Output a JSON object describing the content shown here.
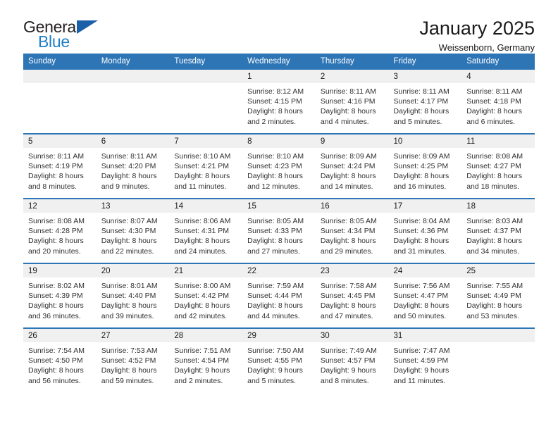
{
  "brand": {
    "name_part1": "General",
    "name_part2": "Blue",
    "triangle_icon": "triangle-icon",
    "accent_color": "#1f7fc4",
    "logo_dark_color": "#231f20"
  },
  "header": {
    "title": "January 2025",
    "subtitle": "Weissenborn, Germany"
  },
  "theme": {
    "header_blue": "#2e75b6",
    "daynum_band": "#f0f0f0",
    "text_color": "#303030"
  },
  "calendar": {
    "weekday_headers": [
      "Sunday",
      "Monday",
      "Tuesday",
      "Wednesday",
      "Thursday",
      "Friday",
      "Saturday"
    ],
    "weeks": [
      [
        {
          "day": "",
          "empty": true,
          "sunrise": "",
          "sunset": "",
          "daylight1": "",
          "daylight2": ""
        },
        {
          "day": "",
          "empty": true,
          "sunrise": "",
          "sunset": "",
          "daylight1": "",
          "daylight2": ""
        },
        {
          "day": "",
          "empty": true,
          "sunrise": "",
          "sunset": "",
          "daylight1": "",
          "daylight2": ""
        },
        {
          "day": "1",
          "empty": false,
          "sunrise": "Sunrise: 8:12 AM",
          "sunset": "Sunset: 4:15 PM",
          "daylight1": "Daylight: 8 hours",
          "daylight2": "and 2 minutes."
        },
        {
          "day": "2",
          "empty": false,
          "sunrise": "Sunrise: 8:11 AM",
          "sunset": "Sunset: 4:16 PM",
          "daylight1": "Daylight: 8 hours",
          "daylight2": "and 4 minutes."
        },
        {
          "day": "3",
          "empty": false,
          "sunrise": "Sunrise: 8:11 AM",
          "sunset": "Sunset: 4:17 PM",
          "daylight1": "Daylight: 8 hours",
          "daylight2": "and 5 minutes."
        },
        {
          "day": "4",
          "empty": false,
          "sunrise": "Sunrise: 8:11 AM",
          "sunset": "Sunset: 4:18 PM",
          "daylight1": "Daylight: 8 hours",
          "daylight2": "and 6 minutes."
        }
      ],
      [
        {
          "day": "5",
          "empty": false,
          "sunrise": "Sunrise: 8:11 AM",
          "sunset": "Sunset: 4:19 PM",
          "daylight1": "Daylight: 8 hours",
          "daylight2": "and 8 minutes."
        },
        {
          "day": "6",
          "empty": false,
          "sunrise": "Sunrise: 8:11 AM",
          "sunset": "Sunset: 4:20 PM",
          "daylight1": "Daylight: 8 hours",
          "daylight2": "and 9 minutes."
        },
        {
          "day": "7",
          "empty": false,
          "sunrise": "Sunrise: 8:10 AM",
          "sunset": "Sunset: 4:21 PM",
          "daylight1": "Daylight: 8 hours",
          "daylight2": "and 11 minutes."
        },
        {
          "day": "8",
          "empty": false,
          "sunrise": "Sunrise: 8:10 AM",
          "sunset": "Sunset: 4:23 PM",
          "daylight1": "Daylight: 8 hours",
          "daylight2": "and 12 minutes."
        },
        {
          "day": "9",
          "empty": false,
          "sunrise": "Sunrise: 8:09 AM",
          "sunset": "Sunset: 4:24 PM",
          "daylight1": "Daylight: 8 hours",
          "daylight2": "and 14 minutes."
        },
        {
          "day": "10",
          "empty": false,
          "sunrise": "Sunrise: 8:09 AM",
          "sunset": "Sunset: 4:25 PM",
          "daylight1": "Daylight: 8 hours",
          "daylight2": "and 16 minutes."
        },
        {
          "day": "11",
          "empty": false,
          "sunrise": "Sunrise: 8:08 AM",
          "sunset": "Sunset: 4:27 PM",
          "daylight1": "Daylight: 8 hours",
          "daylight2": "and 18 minutes."
        }
      ],
      [
        {
          "day": "12",
          "empty": false,
          "sunrise": "Sunrise: 8:08 AM",
          "sunset": "Sunset: 4:28 PM",
          "daylight1": "Daylight: 8 hours",
          "daylight2": "and 20 minutes."
        },
        {
          "day": "13",
          "empty": false,
          "sunrise": "Sunrise: 8:07 AM",
          "sunset": "Sunset: 4:30 PM",
          "daylight1": "Daylight: 8 hours",
          "daylight2": "and 22 minutes."
        },
        {
          "day": "14",
          "empty": false,
          "sunrise": "Sunrise: 8:06 AM",
          "sunset": "Sunset: 4:31 PM",
          "daylight1": "Daylight: 8 hours",
          "daylight2": "and 24 minutes."
        },
        {
          "day": "15",
          "empty": false,
          "sunrise": "Sunrise: 8:05 AM",
          "sunset": "Sunset: 4:33 PM",
          "daylight1": "Daylight: 8 hours",
          "daylight2": "and 27 minutes."
        },
        {
          "day": "16",
          "empty": false,
          "sunrise": "Sunrise: 8:05 AM",
          "sunset": "Sunset: 4:34 PM",
          "daylight1": "Daylight: 8 hours",
          "daylight2": "and 29 minutes."
        },
        {
          "day": "17",
          "empty": false,
          "sunrise": "Sunrise: 8:04 AM",
          "sunset": "Sunset: 4:36 PM",
          "daylight1": "Daylight: 8 hours",
          "daylight2": "and 31 minutes."
        },
        {
          "day": "18",
          "empty": false,
          "sunrise": "Sunrise: 8:03 AM",
          "sunset": "Sunset: 4:37 PM",
          "daylight1": "Daylight: 8 hours",
          "daylight2": "and 34 minutes."
        }
      ],
      [
        {
          "day": "19",
          "empty": false,
          "sunrise": "Sunrise: 8:02 AM",
          "sunset": "Sunset: 4:39 PM",
          "daylight1": "Daylight: 8 hours",
          "daylight2": "and 36 minutes."
        },
        {
          "day": "20",
          "empty": false,
          "sunrise": "Sunrise: 8:01 AM",
          "sunset": "Sunset: 4:40 PM",
          "daylight1": "Daylight: 8 hours",
          "daylight2": "and 39 minutes."
        },
        {
          "day": "21",
          "empty": false,
          "sunrise": "Sunrise: 8:00 AM",
          "sunset": "Sunset: 4:42 PM",
          "daylight1": "Daylight: 8 hours",
          "daylight2": "and 42 minutes."
        },
        {
          "day": "22",
          "empty": false,
          "sunrise": "Sunrise: 7:59 AM",
          "sunset": "Sunset: 4:44 PM",
          "daylight1": "Daylight: 8 hours",
          "daylight2": "and 44 minutes."
        },
        {
          "day": "23",
          "empty": false,
          "sunrise": "Sunrise: 7:58 AM",
          "sunset": "Sunset: 4:45 PM",
          "daylight1": "Daylight: 8 hours",
          "daylight2": "and 47 minutes."
        },
        {
          "day": "24",
          "empty": false,
          "sunrise": "Sunrise: 7:56 AM",
          "sunset": "Sunset: 4:47 PM",
          "daylight1": "Daylight: 8 hours",
          "daylight2": "and 50 minutes."
        },
        {
          "day": "25",
          "empty": false,
          "sunrise": "Sunrise: 7:55 AM",
          "sunset": "Sunset: 4:49 PM",
          "daylight1": "Daylight: 8 hours",
          "daylight2": "and 53 minutes."
        }
      ],
      [
        {
          "day": "26",
          "empty": false,
          "sunrise": "Sunrise: 7:54 AM",
          "sunset": "Sunset: 4:50 PM",
          "daylight1": "Daylight: 8 hours",
          "daylight2": "and 56 minutes."
        },
        {
          "day": "27",
          "empty": false,
          "sunrise": "Sunrise: 7:53 AM",
          "sunset": "Sunset: 4:52 PM",
          "daylight1": "Daylight: 8 hours",
          "daylight2": "and 59 minutes."
        },
        {
          "day": "28",
          "empty": false,
          "sunrise": "Sunrise: 7:51 AM",
          "sunset": "Sunset: 4:54 PM",
          "daylight1": "Daylight: 9 hours",
          "daylight2": "and 2 minutes."
        },
        {
          "day": "29",
          "empty": false,
          "sunrise": "Sunrise: 7:50 AM",
          "sunset": "Sunset: 4:55 PM",
          "daylight1": "Daylight: 9 hours",
          "daylight2": "and 5 minutes."
        },
        {
          "day": "30",
          "empty": false,
          "sunrise": "Sunrise: 7:49 AM",
          "sunset": "Sunset: 4:57 PM",
          "daylight1": "Daylight: 9 hours",
          "daylight2": "and 8 minutes."
        },
        {
          "day": "31",
          "empty": false,
          "sunrise": "Sunrise: 7:47 AM",
          "sunset": "Sunset: 4:59 PM",
          "daylight1": "Daylight: 9 hours",
          "daylight2": "and 11 minutes."
        },
        {
          "day": "",
          "empty": true,
          "sunrise": "",
          "sunset": "",
          "daylight1": "",
          "daylight2": ""
        }
      ]
    ]
  }
}
